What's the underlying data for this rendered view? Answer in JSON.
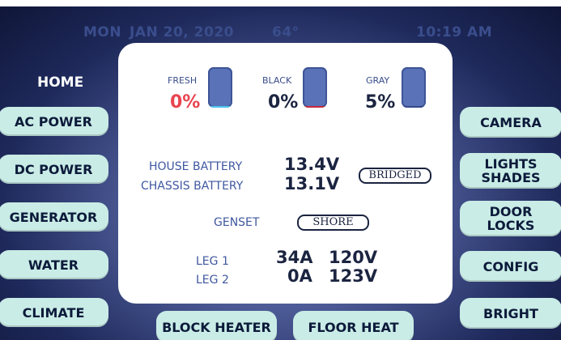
{
  "status_bar": {
    "day": "MON",
    "date": "JAN 20, 2020",
    "temp": "64°",
    "time": "10:19 AM"
  },
  "nav": {
    "home": "HOME"
  },
  "left_buttons": [
    "AC POWER",
    "DC POWER",
    "GENERATOR",
    "WATER",
    "CLIMATE"
  ],
  "right_buttons": [
    "CAMERA",
    "LIGHTS\nSHADES",
    "DOOR\nLOCKS",
    "CONFIG",
    "BRIGHT"
  ],
  "bottom_buttons": [
    "BLOCK HEATER",
    "FLOOR HEAT"
  ],
  "tanks": [
    {
      "label": "FRESH",
      "percent": "0%",
      "level": 0,
      "color": "#e84550",
      "fill_color": "#4fc3f0"
    },
    {
      "label": "BLACK",
      "percent": "0%",
      "level": 0,
      "color": "#1b2440",
      "fill_color": "#c8283a"
    },
    {
      "label": "GRAY",
      "percent": "5%",
      "level": 0.05,
      "color": "#1b2440",
      "fill_color": "#34488a"
    }
  ],
  "battery": {
    "house_label": "HOUSE BATTERY",
    "house_value": "13.4V",
    "chassis_label": "CHASSIS BATTERY",
    "chassis_value": "13.1V",
    "bridged": "BRIDGED"
  },
  "power": {
    "genset_label": "GENSET",
    "source": "SHORE",
    "leg1_label": "LEG 1",
    "leg1_amps": "34A",
    "leg1_volts": "120V",
    "leg2_label": "LEG 2",
    "leg2_amps": "0A",
    "leg2_volts": "123V"
  }
}
